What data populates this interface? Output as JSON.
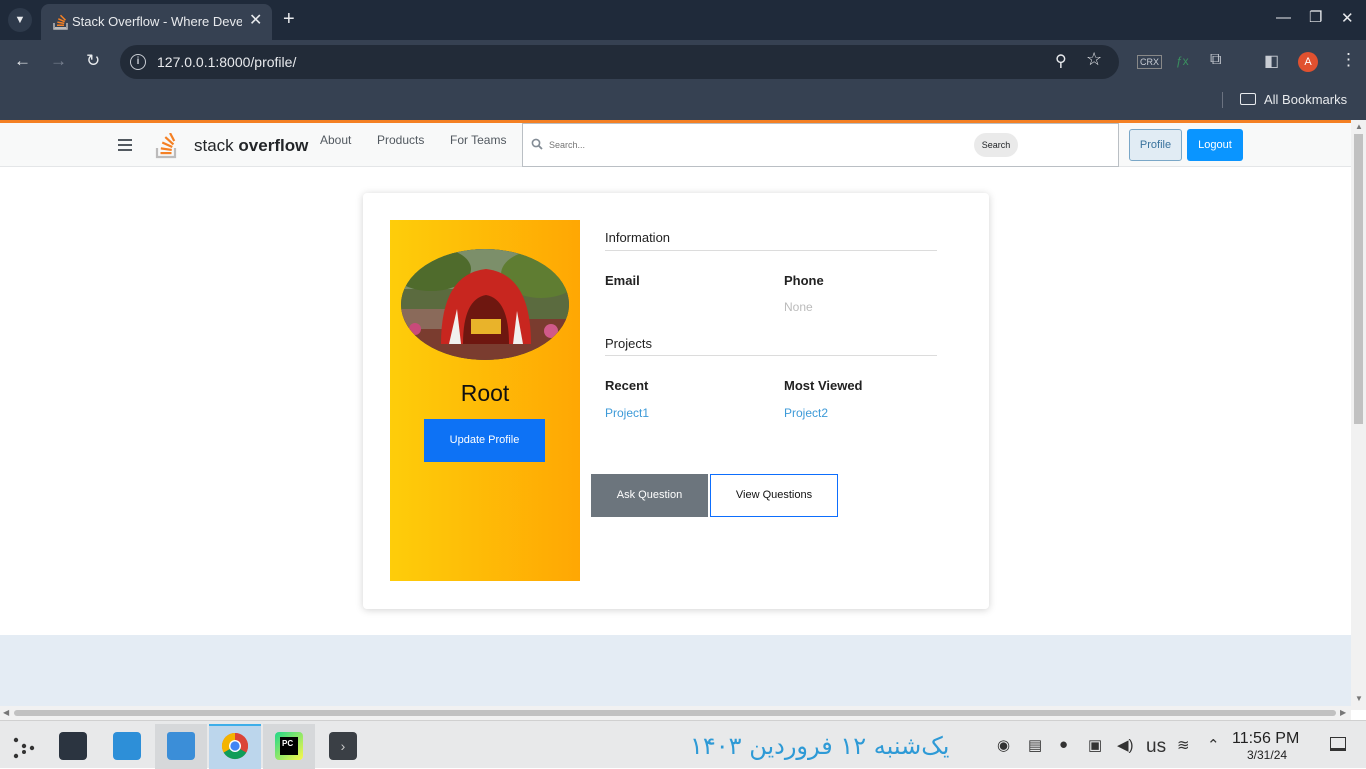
{
  "browser": {
    "tab_title": "Stack Overflow - Where Developers Learn, Share, & Build Careers",
    "url": "127.0.0.1:8000/profile/",
    "bookmarks_label": "All Bookmarks",
    "profile_initial": "A",
    "ext_crx": "CRX",
    "colors": {
      "chrome_bg": "#1f2a3a",
      "toolbar_bg": "#364152",
      "avatar": "#e1512f"
    }
  },
  "so_nav": {
    "brand_light": "stack ",
    "brand_bold": "overflow",
    "links": [
      "About",
      "Products",
      "For Teams"
    ],
    "search_placeholder": "Search...",
    "search_button": "Search",
    "profile_button": "Profile",
    "logout_button": "Logout",
    "colors": {
      "accent": "#f48024",
      "primary": "#0a95ff"
    }
  },
  "profile": {
    "name": "Root",
    "update_button": "Update Profile",
    "information_heading": "Information",
    "email_label": "Email",
    "email_value": "",
    "phone_label": "Phone",
    "phone_value": "None",
    "projects_heading": "Projects",
    "recent_label": "Recent",
    "recent_link": "Project1",
    "most_viewed_label": "Most Viewed",
    "most_viewed_link": "Project2",
    "ask_button": "Ask Question",
    "view_button": "View Questions",
    "colors": {
      "panel_from": "#fecd0a",
      "panel_to": "#ffa703",
      "update_btn": "#0d72f5",
      "ask_btn": "#6c757d",
      "link": "#3d9ad8"
    }
  },
  "taskbar": {
    "persian_date": "یک‌شنبه ۱۲ فروردین ۱۴۰۳",
    "keyboard_layout": "us",
    "time": "11:56 PM",
    "date": "3/31/24"
  }
}
